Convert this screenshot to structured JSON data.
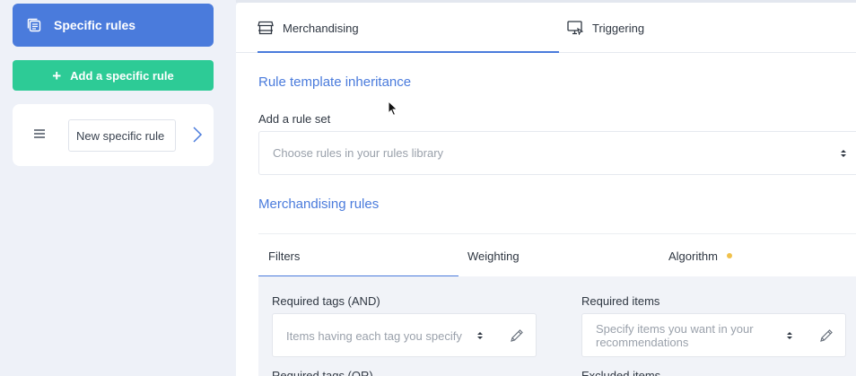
{
  "sidebar": {
    "header": {
      "title": "Specific rules",
      "icon": "copy-stack-icon"
    },
    "add_button": {
      "label": "Add a specific rule",
      "icon": "plus-icon"
    },
    "rules": [
      {
        "name": "New specific rule"
      }
    ]
  },
  "main": {
    "tabs": [
      {
        "label": "Merchandising",
        "icon": "store-icon",
        "active": true
      },
      {
        "label": "Triggering",
        "icon": "monitor-icon",
        "active": false
      }
    ],
    "inheritance": {
      "title": "Rule template inheritance",
      "add_rule_set_label": "Add a rule set",
      "select_placeholder": "Choose rules in your rules library"
    },
    "merch_rules": {
      "title": "Merchandising rules",
      "sub_tabs": [
        {
          "label": "Filters",
          "active": true
        },
        {
          "label": "Weighting",
          "active": false
        },
        {
          "label": "Algorithm",
          "active": false,
          "has_dot": true
        }
      ],
      "filters": {
        "required_tags_and": {
          "label": "Required tags (AND)",
          "placeholder": "Items having each tag you specify"
        },
        "required_items": {
          "label": "Required items",
          "placeholder": "Specify items you want in your recommendations"
        },
        "required_tags_or": {
          "label": "Required tags (OR)"
        },
        "excluded_items": {
          "label": "Excluded items"
        }
      }
    }
  },
  "colors": {
    "accent": "#4a7bdc",
    "add_button": "#2dcb96",
    "dot": "#f0c14b",
    "background": "#eef1f8"
  }
}
